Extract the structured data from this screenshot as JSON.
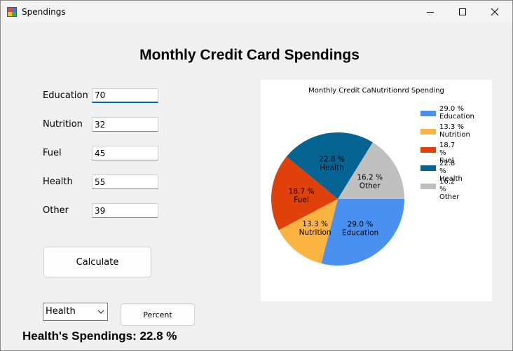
{
  "window": {
    "title": "Spendings"
  },
  "heading": "Monthly Credit Card Spendings",
  "fields": [
    {
      "label": "Education",
      "value": "70"
    },
    {
      "label": "Nutrition",
      "value": "32"
    },
    {
      "label": "Fuel",
      "value": "45"
    },
    {
      "label": "Health",
      "value": "55"
    },
    {
      "label": "Other",
      "value": "39"
    }
  ],
  "calculate_button": "Calculate",
  "category_select": {
    "selected": "Health"
  },
  "percent_button": "Percent",
  "result_text": "Health's Spendings: 22.8 %",
  "chart_data": {
    "type": "pie",
    "title": "Monthly Credit CaNutritionrd Spending",
    "slices": [
      {
        "name": "Education",
        "label": "29.0 %",
        "value": 29.0,
        "color": "#4a90f0"
      },
      {
        "name": "Nutrition",
        "label": "13.3 %",
        "value": 13.3,
        "color": "#fcb441"
      },
      {
        "name": "Fuel",
        "label": "18.7 %",
        "value": 18.7,
        "color": "#e0400a"
      },
      {
        "name": "Health",
        "label": "22.8 %",
        "value": 22.8,
        "color": "#056492"
      },
      {
        "name": "Other",
        "label": "16.2  %",
        "value": 16.2,
        "color": "#bfbfbf"
      }
    ],
    "legend_position": "top-right"
  }
}
